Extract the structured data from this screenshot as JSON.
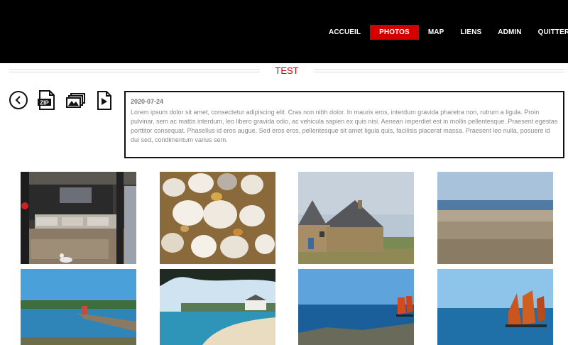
{
  "nav": {
    "items": [
      "ACCUEIL",
      "PHOTOS",
      "MAP",
      "LIENS",
      "ADMIN",
      "QUITTER"
    ],
    "active_index": 1,
    "active_color": "#d40000"
  },
  "album": {
    "title": "TEST",
    "date": "2020-07-24",
    "description": "Lorem ipsum dolor sit amet, consectetur adipiscing elit. Cras non nibh dolor. In mauris eros, interdum gravida pharetra non, rutrum a ligula. Proin pulvinar, sem ac mattis interdum, leo libero gravida odio, ac vehicula sapien ex quis nisi. Aenean imperdiet est in mollis pellentesque. Praesent egestas porttitor consequat. Phasellus id eros augue. Sed eros eros, pellentesque sit amet ligula quis, facilisis placerat massa. Praesent leo nulla, posuere id dui sed, condimentum varius sem."
  },
  "toolbar": {
    "icons": [
      "back-arrow-icon",
      "zip-download-icon",
      "slideshow-icon",
      "play-icon"
    ],
    "zip_label": "ZIP"
  },
  "gallery": {
    "photos": [
      "shop-interior",
      "pebbles",
      "stone-chapel",
      "beach",
      "harbor-jetty",
      "cove-beach",
      "sailboat-rocks",
      "sailboat-sea"
    ]
  }
}
